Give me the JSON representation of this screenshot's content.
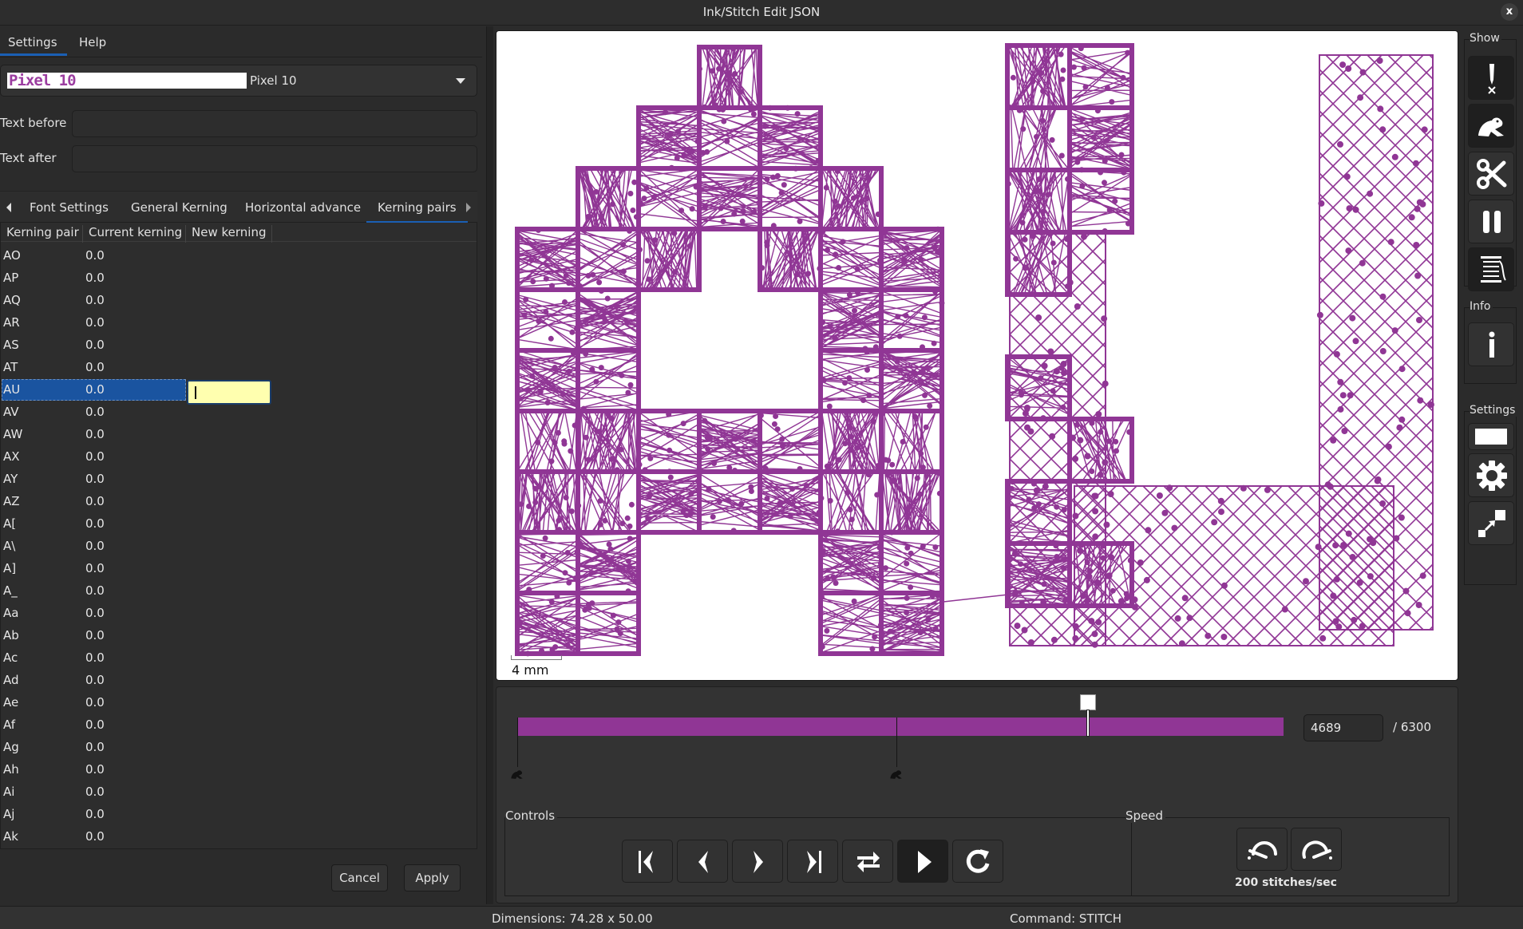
{
  "window": {
    "title": "Ink/Stitch Edit JSON",
    "close_label": "x"
  },
  "main_tabs": [
    {
      "label": "Settings",
      "active": true
    },
    {
      "label": "Help",
      "active": false
    }
  ],
  "font_select": {
    "preview_text": "Pixel 10",
    "selected": "Pixel 10"
  },
  "fields": {
    "text_before_label": "Text before",
    "text_before_value": "",
    "text_after_label": "Text after",
    "text_after_value": ""
  },
  "sub_tabs": [
    {
      "label": "Font Settings",
      "active": false
    },
    {
      "label": "General Kerning",
      "active": false
    },
    {
      "label": "Horizontal advance",
      "active": false
    },
    {
      "label": "Kerning pairs",
      "active": true
    }
  ],
  "kerning_table": {
    "columns": [
      "Kerning pair",
      "Current kerning",
      "New kerning"
    ],
    "selected_index": 6,
    "rows": [
      {
        "pair": "AO",
        "current": "0.0",
        "new": ""
      },
      {
        "pair": "AP",
        "current": "0.0",
        "new": ""
      },
      {
        "pair": "AQ",
        "current": "0.0",
        "new": ""
      },
      {
        "pair": "AR",
        "current": "0.0",
        "new": ""
      },
      {
        "pair": "AS",
        "current": "0.0",
        "new": ""
      },
      {
        "pair": "AT",
        "current": "0.0",
        "new": ""
      },
      {
        "pair": "AU",
        "current": "0.0",
        "new": ""
      },
      {
        "pair": "AV",
        "current": "0.0",
        "new": ""
      },
      {
        "pair": "AW",
        "current": "0.0",
        "new": ""
      },
      {
        "pair": "AX",
        "current": "0.0",
        "new": ""
      },
      {
        "pair": "AY",
        "current": "0.0",
        "new": ""
      },
      {
        "pair": "AZ",
        "current": "0.0",
        "new": ""
      },
      {
        "pair": "A[",
        "current": "0.0",
        "new": ""
      },
      {
        "pair": "A\\",
        "current": "0.0",
        "new": ""
      },
      {
        "pair": "A]",
        "current": "0.0",
        "new": ""
      },
      {
        "pair": "A_",
        "current": "0.0",
        "new": ""
      },
      {
        "pair": "Aa",
        "current": "0.0",
        "new": ""
      },
      {
        "pair": "Ab",
        "current": "0.0",
        "new": ""
      },
      {
        "pair": "Ac",
        "current": "0.0",
        "new": ""
      },
      {
        "pair": "Ad",
        "current": "0.0",
        "new": ""
      },
      {
        "pair": "Ae",
        "current": "0.0",
        "new": ""
      },
      {
        "pair": "Af",
        "current": "0.0",
        "new": ""
      },
      {
        "pair": "Ag",
        "current": "0.0",
        "new": ""
      },
      {
        "pair": "Ah",
        "current": "0.0",
        "new": ""
      },
      {
        "pair": "Ai",
        "current": "0.0",
        "new": ""
      },
      {
        "pair": "Aj",
        "current": "0.0",
        "new": ""
      },
      {
        "pair": "Ak",
        "current": "0.0",
        "new": ""
      }
    ]
  },
  "buttons": {
    "cancel": "Cancel",
    "apply": "Apply"
  },
  "preview": {
    "scale_label": "4 mm",
    "stitch_color": "#903695",
    "preview_text": "AU"
  },
  "simulator": {
    "current_stitch": "4689",
    "total_label": "/ 6300",
    "current_value": 4689,
    "total_value": 6300,
    "jump_markers_fraction": [
      0.0,
      0.495
    ],
    "controls_label": "Controls",
    "controls": [
      {
        "name": "jump-to-start",
        "icon": "first-icon"
      },
      {
        "name": "step-back",
        "icon": "previous-icon"
      },
      {
        "name": "step-forward",
        "icon": "next-icon"
      },
      {
        "name": "jump-to-end",
        "icon": "last-icon"
      },
      {
        "name": "toggle-direction",
        "icon": "direction-icon"
      },
      {
        "name": "play",
        "icon": "play-icon",
        "active": true
      },
      {
        "name": "restart",
        "icon": "restart-icon"
      }
    ],
    "speed_label": "Speed",
    "speed_text": "200 stitches/sec"
  },
  "right_toolbar": {
    "show_label": "Show",
    "info_label": "Info",
    "settings_label": "Settings",
    "show_buttons": [
      "needle-penetration-icon",
      "jump-stitch-icon",
      "trim-icon",
      "stop-icon",
      "color-change-icon"
    ],
    "info_buttons": [
      "info-icon"
    ],
    "settings_buttons": [
      "background-color-icon",
      "settings-gear-icon",
      "resize-icon"
    ]
  },
  "status": {
    "dimensions": "Dimensions: 74.28 x 50.00",
    "command": "Command: STITCH"
  }
}
